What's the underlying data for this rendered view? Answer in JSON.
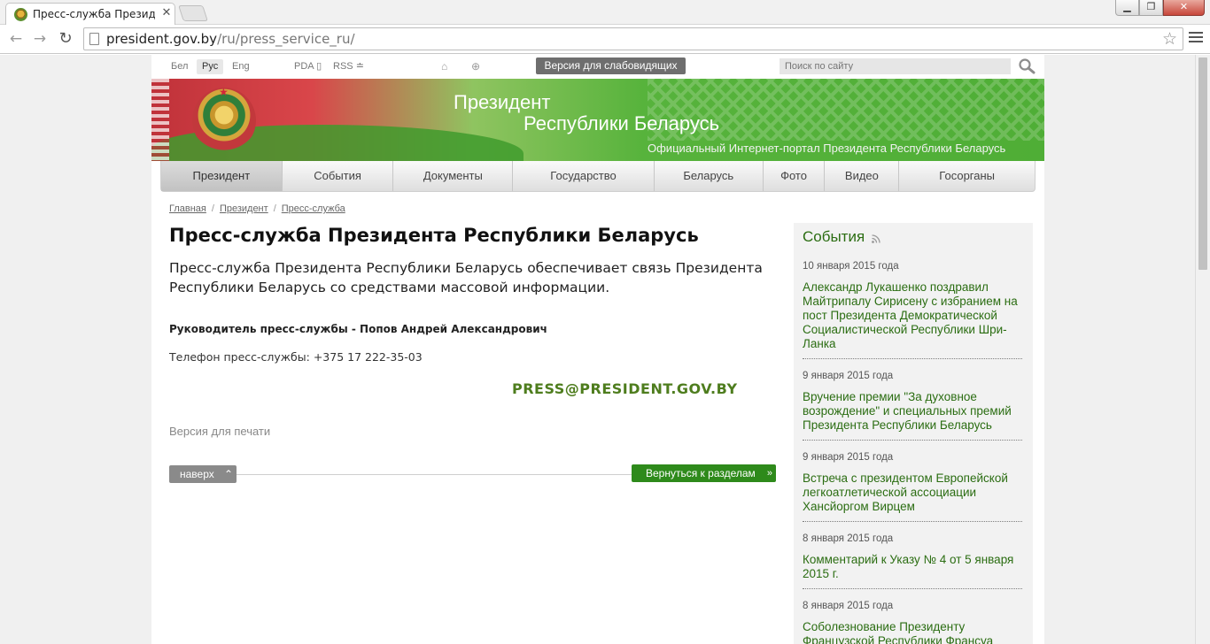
{
  "browser": {
    "tab_title": "Пресс-служба Президен",
    "tab_close": "✕",
    "url_host": "president.gov.by",
    "url_path": "/ru/press_service_ru/",
    "win_min": "▁",
    "win_max": "❐",
    "win_close": "✕"
  },
  "util": {
    "lang_be": "Бел",
    "lang_ru": "Рус",
    "lang_en": "Eng",
    "pda": "PDA",
    "rss": "RSS",
    "low_vision": "Версия для слабовидящих",
    "search_placeholder": "Поиск по сайту"
  },
  "banner": {
    "title_line1": "Президент",
    "title_line2": "Республики Беларусь",
    "subtitle": "Официальный Интернет-портал Президента Республики Беларусь"
  },
  "nav": {
    "items": [
      "Президент",
      "События",
      "Документы",
      "Государство",
      "Беларусь",
      "Фото",
      "Видео",
      "Госорганы"
    ]
  },
  "breadcrumb": {
    "home": "Главная",
    "president": "Президент",
    "current": "Пресс-служба"
  },
  "content": {
    "title": "Пресс-служба Президента Республики Беларусь",
    "lead": "Пресс-служба Президента Республики Беларусь обеспечивает связь Президента Республики Беларусь со средствами массовой информации.",
    "head": "Руководитель пресс-службы - Попов Андрей Александрович",
    "phone": "Телефон пресс-службы: +375 17 222-35-03",
    "email": "PRESS@PRESIDENT.GOV.BY",
    "print": "Версия для печати",
    "up": "наверх",
    "back": "Вернуться к разделам"
  },
  "sidebar": {
    "title": "События",
    "news": [
      {
        "date": "10 января 2015 года",
        "text": "Александр Лукашенко поздравил Майтрипалу Сирисену с избранием на пост Президента Демократической Социалистической Республики Шри-Ланка"
      },
      {
        "date": "9 января 2015 года",
        "text": "Вручение премии \"За духовное возрождение\" и специальных премий Президента Республики Беларусь"
      },
      {
        "date": "9 января 2015 года",
        "text": "Встреча с президентом Европейской легкоатлетической ассоциации Хансйоргом Вирцем"
      },
      {
        "date": "8 января 2015 года",
        "text": "Комментарий к Указу № 4 от 5 января 2015 г."
      },
      {
        "date": "8 января 2015 года",
        "text": "Соболезнование Президенту Французской Республики Франсуа"
      }
    ]
  },
  "colors": {
    "brand_green": "#2b6d12",
    "email_green": "#4e7d1e",
    "button_green": "#2e8a1b",
    "flag_red": "#c0323a"
  }
}
